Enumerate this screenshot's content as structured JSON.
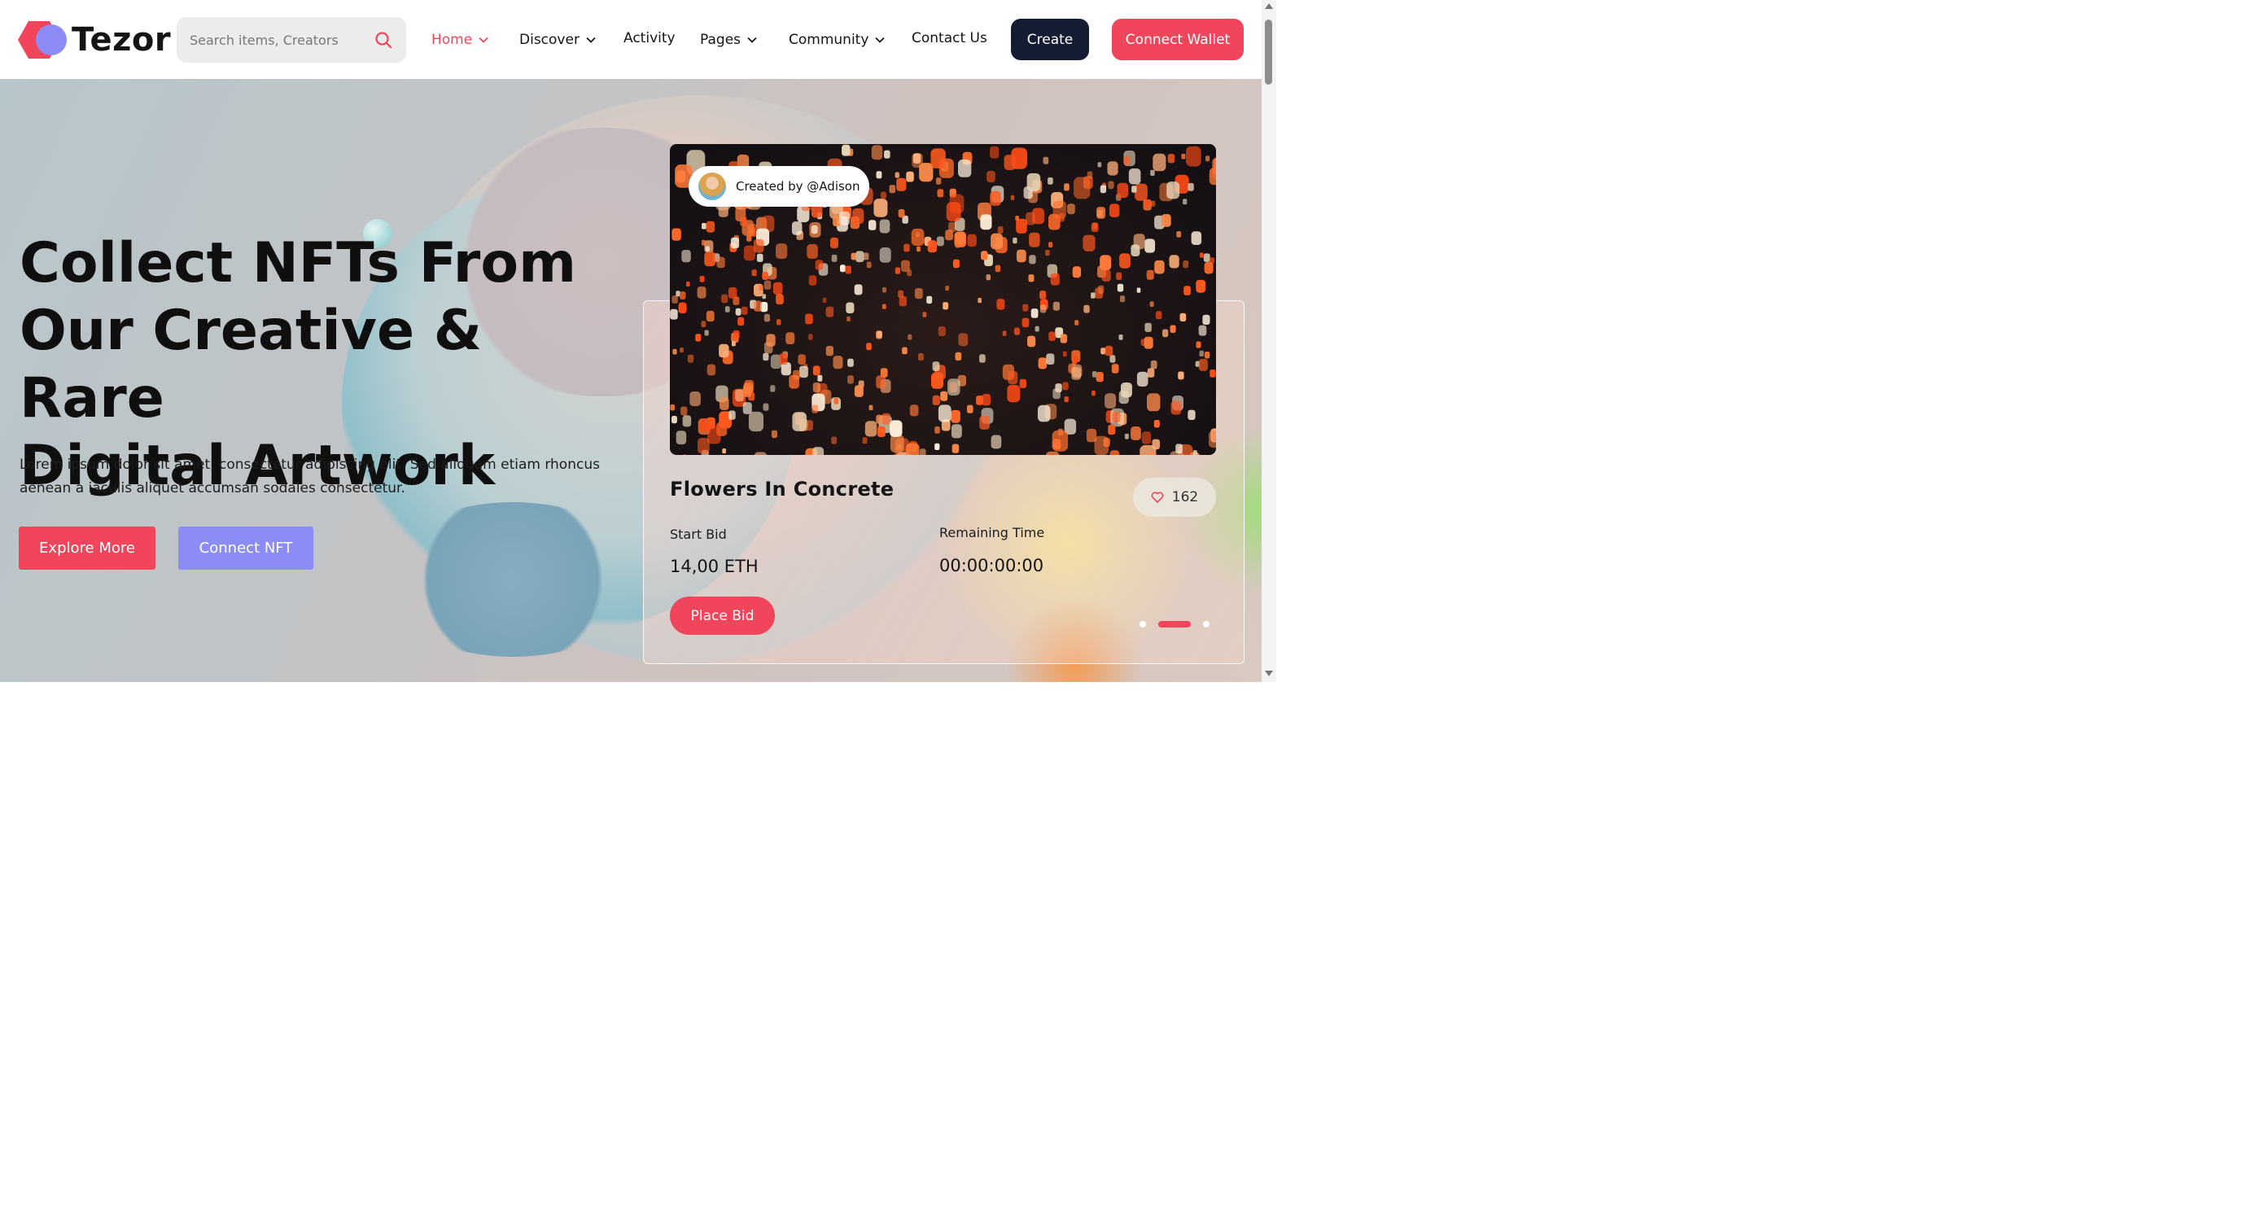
{
  "brand": {
    "name": "Tezor",
    "accent": "#f0455a",
    "secondary": "#8c8cf7",
    "dark": "#141d33"
  },
  "search": {
    "placeholder": "Search items, Creators",
    "icon": "search-icon"
  },
  "nav": [
    {
      "label": "Home",
      "active": true,
      "dropdown": true
    },
    {
      "label": "Discover",
      "active": false,
      "dropdown": true
    },
    {
      "label": "Activity",
      "active": false,
      "dropdown": false
    },
    {
      "label": "Pages",
      "active": false,
      "dropdown": true
    },
    {
      "label": "Community",
      "active": false,
      "dropdown": true
    },
    {
      "label": "Contact Us",
      "active": false,
      "dropdown": false
    }
  ],
  "header_buttons": {
    "create": "Create",
    "connect_wallet": "Connect Wallet"
  },
  "hero": {
    "title_lines": [
      "Collect NFTs From",
      "Our Creative & Rare",
      "Digital Artwork"
    ],
    "description": "Lorem ipsum dolor sit amet, consectetur adipiscing elit. Sed aliquam etiam rhoncus aenean a iaculis aliquet accumsan sodales consectetur.",
    "explore_button": "Explore More",
    "connect_nft_button": "Connect NFT"
  },
  "nft_card": {
    "creator": "Created by @Adison",
    "title": "Flowers In Concrete",
    "likes": "162",
    "start_bid_label": "Start Bid",
    "start_bid_value": "14,00 ETH",
    "remaining_label": "Remaining Time",
    "remaining_value": "00:00:00:00",
    "place_bid_button": "Place Bid"
  },
  "carousel": {
    "slides": 3,
    "active_index": 1
  }
}
